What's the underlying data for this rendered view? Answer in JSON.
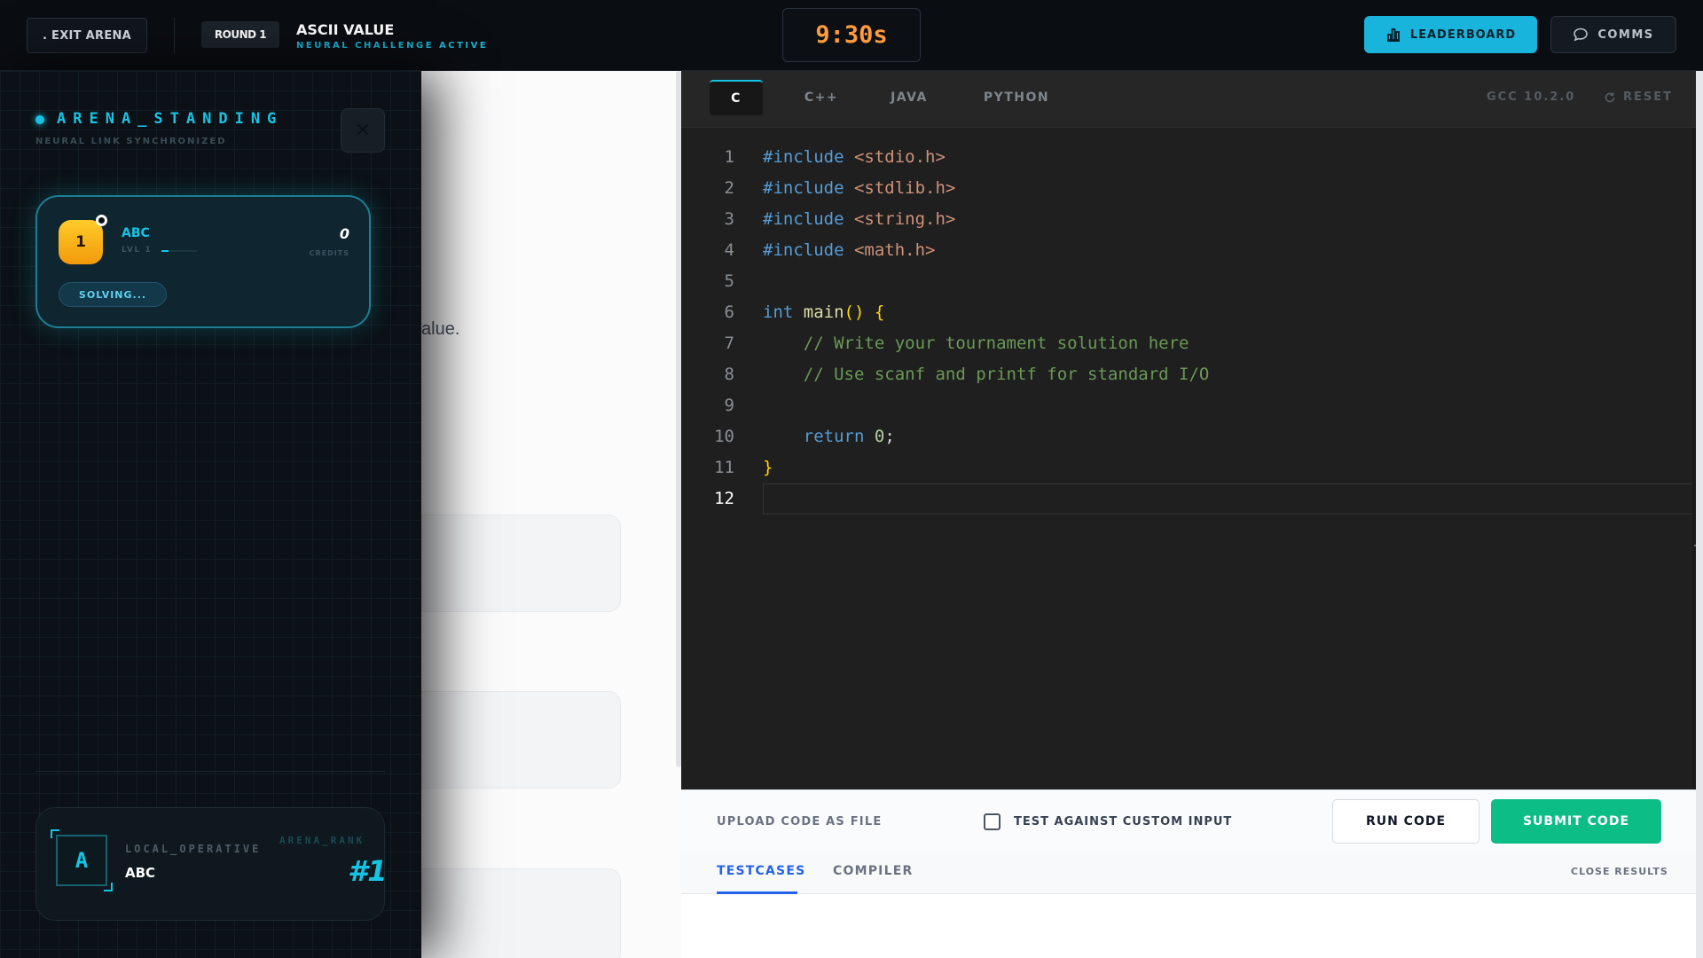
{
  "header": {
    "exit_label": ". EXIT ARENA",
    "round_label": "ROUND 1",
    "problem_title": "ASCII VALUE",
    "status": "NEURAL CHALLENGE ACTIVE",
    "timer": "9:30s",
    "leaderboard_label": "LEADERBOARD",
    "comms_label": "COMMS"
  },
  "problem": {
    "visible_text": "alue."
  },
  "sidebar": {
    "title": "ARENA_STANDING",
    "subtitle": "NEURAL LINK SYNCHRONIZED",
    "close_icon": "✕",
    "player": {
      "rank": "1",
      "name": "ABC",
      "level": "LVL 1",
      "level_progress": 0.2,
      "credits": "0",
      "credits_label": "CREDITS",
      "status": "SOLVING..."
    },
    "local": {
      "avatar_letter": "A",
      "label": "LOCAL_OPERATIVE",
      "name": "ABC",
      "rank_label": "ARENA_RANK",
      "rank": "#1"
    }
  },
  "editor": {
    "tabs": [
      {
        "label": "C",
        "active": true
      },
      {
        "label": "C++",
        "active": false
      },
      {
        "label": "JAVA",
        "active": false
      },
      {
        "label": "PYTHON",
        "active": false
      }
    ],
    "compiler": "GCC 10.2.0",
    "reset_label": "RESET",
    "current_line": 12,
    "lines": [
      {
        "n": "1",
        "text": "#include <stdio.h>"
      },
      {
        "n": "2",
        "text": "#include <stdlib.h>"
      },
      {
        "n": "3",
        "text": "#include <string.h>"
      },
      {
        "n": "4",
        "text": "#include <math.h>"
      },
      {
        "n": "5",
        "text": ""
      },
      {
        "n": "6",
        "text": "int main() {"
      },
      {
        "n": "7",
        "text": "    // Write your tournament solution here"
      },
      {
        "n": "8",
        "text": "    // Use scanf and printf for standard I/O"
      },
      {
        "n": "9",
        "text": ""
      },
      {
        "n": "10",
        "text": "    return 0;"
      },
      {
        "n": "11",
        "text": "}"
      },
      {
        "n": "12",
        "text": ""
      }
    ]
  },
  "actions": {
    "upload_label": "UPLOAD CODE AS FILE",
    "custom_input_label": "TEST AGAINST CUSTOM INPUT",
    "custom_input_checked": false,
    "run_label": "RUN CODE",
    "submit_label": "SUBMIT CODE"
  },
  "results": {
    "tabs": [
      {
        "label": "TESTCASES",
        "active": true
      },
      {
        "label": "COMPILER",
        "active": false
      }
    ],
    "close_label": "CLOSE RESULTS"
  },
  "colors": {
    "accent": "#17c3e4",
    "timer": "#ff9b3d",
    "submit": "#0cbd85",
    "active_tab": "#2563eb"
  },
  "icons": {
    "leaderboard": "bar-chart-icon",
    "comms": "chat-bubble-icon",
    "reset": "refresh-icon",
    "close": "close-icon"
  }
}
